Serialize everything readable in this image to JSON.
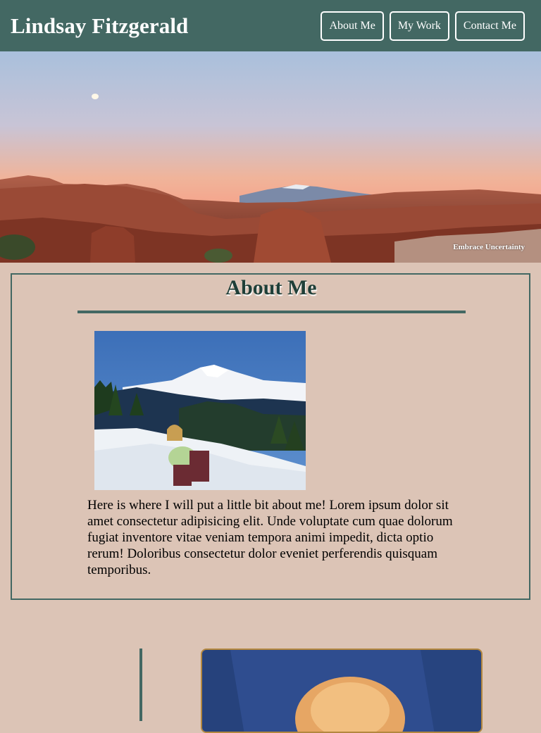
{
  "header": {
    "site_name": "Lindsay Fitzgerald",
    "nav": [
      {
        "label": "About Me"
      },
      {
        "label": "My Work"
      },
      {
        "label": "Contact Me"
      }
    ]
  },
  "hero": {
    "caption": "Embrace Uncertainty"
  },
  "about": {
    "title": "About Me",
    "text": "Here is where I will put a little bit about me! Lorem ipsum dolor sit amet consectetur adipisicing elit. Unde voluptate cum quae dolorum fugiat inventore vitae veniam tempora animi impedit, dicta optio rerum! Doloribus consectetur dolor eveniet perferendis quisquam temporibus."
  },
  "colors": {
    "header_bg": "#436863",
    "page_bg": "#dcc4b6",
    "accent": "#436863",
    "title_text": "#1f3f38",
    "photo_border": "#b3873f"
  }
}
